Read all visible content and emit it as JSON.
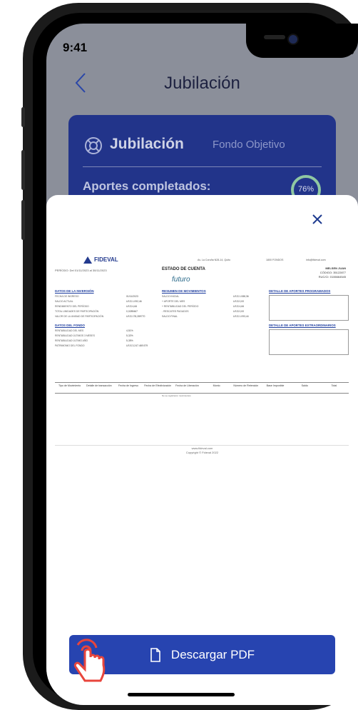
{
  "status_bar": {
    "time": "9:41",
    "signal_wifi": ".ıl ᯤ"
  },
  "header": {
    "back_icon": "chevron-left-icon",
    "title": "Jubilación"
  },
  "card": {
    "icon": "lifebuoy-icon",
    "title": "Jubilación",
    "subtitle": "Fondo Objetivo",
    "aportes_label": "Aportes completados:",
    "progress_percent": 76,
    "progress_label": "76%"
  },
  "sheet": {
    "close_icon": "close-icon",
    "document": {
      "brand": "FIDEVAL",
      "period": "PERÍODO: Del 01/11/2023 al 30/11/2023",
      "address": "Av. La Coruña N28-14, Quito",
      "phone": "1800 FONDOS",
      "email": "info@fideval.com",
      "title": "ESTADO DE CUENTA",
      "product": "futuro",
      "client_name": "MELSEN JUAN",
      "client_code": "CÓDIGO: 35122877",
      "client_ruc": "RUC/CI: 0106664545",
      "sections": {
        "inversion": "DATOS DE LA INVERSIÓN",
        "resumen": "RESUMEN DE MOVIMIENTOS",
        "aportes_prog": "DETALLE DE APORTES PROGRAMADOS",
        "fondo": "DATOS DEL FONDO",
        "aportes_extra": "DETALLE DE APORTES EXTRAORDINARIOS"
      },
      "inversion_rows": "FECHA DE INGRESO\nSALDO ACTUAL\nRENDIMIENTO DEL PERÍODO\nTOTAL UNIDADES DE PARTICIPACIÓN\nVALOR DE LA UNIDAD DE PARTICIPACIÓN",
      "inversion_vals": "01/11/2023\nUS $ 1.092,46\nUS $ 4,66\n0,0289467\nUS $ 178,289770",
      "resumen_rows": "SALDO INICIAL\n+ APORTE DEL MES\n+ RENTABILIDAD DEL PERÍODO\n- RESCATES PAGADOS\nSALDO FINAL",
      "resumen_vals": "US $ 1.088,36\nUS $ 0,00\nUS $ 4,66\nUS $ 0,00\nUS $ 1.093,44",
      "fondo_rows": "RENTABILIDAD DEL MES\nRENTABILIDAD ÚLTIMOS 3 MESES\nRENTABILIDAD ÚLTIMO AÑO\nPATRIMONIO DEL FONDO",
      "fondo_vals": "4,51%\n5,32%\n5,35%\nUS $ 3.247.469.579",
      "table_headers": [
        "Tipo de Movimiento",
        "Detalle de transacción",
        "Fecha de Ingreso",
        "Fecha de Efectivización",
        "Fecha de Liberación",
        "Monto",
        "Número de Retención",
        "Base Imponible",
        "Saldo",
        "Total"
      ],
      "table_note": "No se registraron movimientos",
      "footer_web": "www.fideval.com",
      "footer_copy": "Copyright © Fideval 2022"
    },
    "download_label": "Descargar PDF",
    "download_icon": "file-icon",
    "hand_icon": "tap-hand-icon"
  }
}
